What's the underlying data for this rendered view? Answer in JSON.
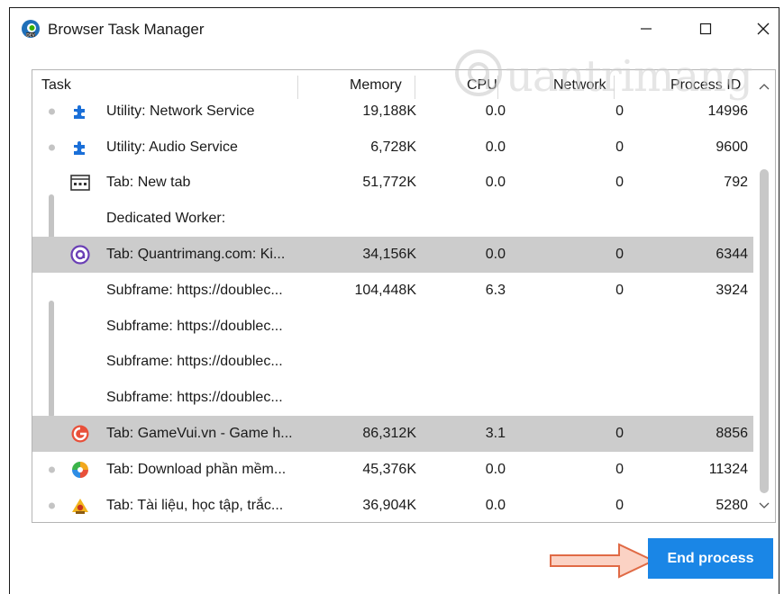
{
  "window": {
    "title": "Browser Task Manager"
  },
  "columns": {
    "task": "Task",
    "memory": "Memory",
    "cpu": "CPU",
    "network": "Network",
    "pid": "Process ID"
  },
  "rows": [
    {
      "task": "Utility: Network Service",
      "memory": "19,188K",
      "cpu": "0.0",
      "network": "0",
      "pid": "14996",
      "icon": "puzzle-icon"
    },
    {
      "task": "Utility: Audio Service",
      "memory": "6,728K",
      "cpu": "0.0",
      "network": "0",
      "pid": "9600",
      "icon": "puzzle-icon"
    },
    {
      "task": "Tab: New tab",
      "memory": "51,772K",
      "cpu": "0.0",
      "network": "0",
      "pid": "792",
      "icon": "new-tab-icon"
    },
    {
      "task": "Dedicated Worker:",
      "memory": "",
      "cpu": "",
      "network": "",
      "pid": "",
      "icon": ""
    },
    {
      "task": "Tab: Quantrimang.com: Ki...",
      "memory": "34,156K",
      "cpu": "0.0",
      "network": "0",
      "pid": "6344",
      "icon": "quantrimang-icon",
      "selected": true
    },
    {
      "task": "Subframe: https://doublec...",
      "memory": "104,448K",
      "cpu": "6.3",
      "network": "0",
      "pid": "3924",
      "icon": ""
    },
    {
      "task": "Subframe: https://doublec...",
      "memory": "",
      "cpu": "",
      "network": "",
      "pid": "",
      "icon": ""
    },
    {
      "task": "Subframe: https://doublec...",
      "memory": "",
      "cpu": "",
      "network": "",
      "pid": "",
      "icon": ""
    },
    {
      "task": "Subframe: https://doublec...",
      "memory": "",
      "cpu": "",
      "network": "",
      "pid": "",
      "icon": ""
    },
    {
      "task": "Tab: GameVui.vn - Game h...",
      "memory": "86,312K",
      "cpu": "3.1",
      "network": "0",
      "pid": "8856",
      "icon": "gamevui-icon",
      "selected": true
    },
    {
      "task": "Tab: Download phần mềm...",
      "memory": "45,376K",
      "cpu": "0.0",
      "network": "0",
      "pid": "11324",
      "icon": "download-site-icon"
    },
    {
      "task": "Tab: Tài liệu, học tập, trắc...",
      "memory": "36,904K",
      "cpu": "0.0",
      "network": "0",
      "pid": "5280",
      "icon": "tailieu-icon"
    }
  ],
  "actions": {
    "end_process": "End process"
  },
  "watermark": "uantrimang",
  "colors": {
    "accent": "#1a86e6",
    "selected_row": "#cccccc",
    "arrow": "#f08060"
  }
}
